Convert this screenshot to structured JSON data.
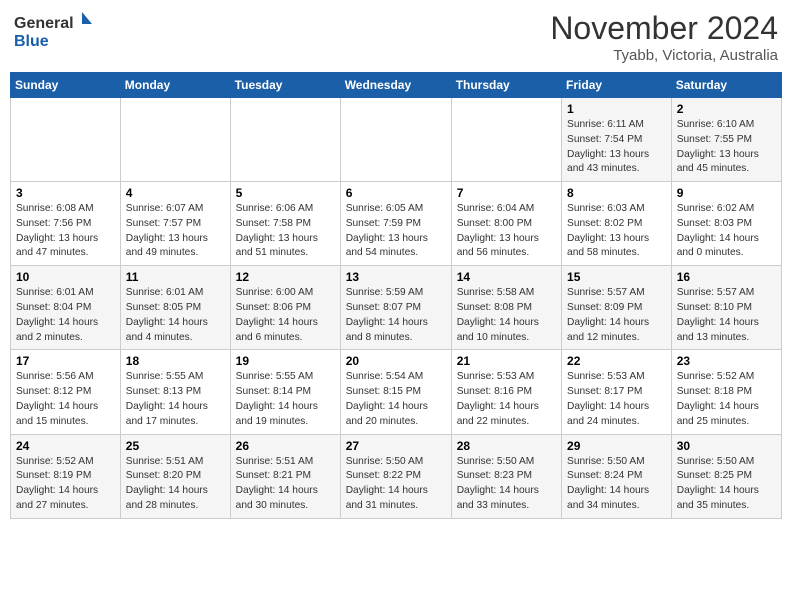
{
  "header": {
    "logo_line1": "General",
    "logo_line2": "Blue",
    "month": "November 2024",
    "location": "Tyabb, Victoria, Australia"
  },
  "weekdays": [
    "Sunday",
    "Monday",
    "Tuesday",
    "Wednesday",
    "Thursday",
    "Friday",
    "Saturday"
  ],
  "weeks": [
    [
      {
        "day": "",
        "info": ""
      },
      {
        "day": "",
        "info": ""
      },
      {
        "day": "",
        "info": ""
      },
      {
        "day": "",
        "info": ""
      },
      {
        "day": "",
        "info": ""
      },
      {
        "day": "1",
        "info": "Sunrise: 6:11 AM\nSunset: 7:54 PM\nDaylight: 13 hours\nand 43 minutes."
      },
      {
        "day": "2",
        "info": "Sunrise: 6:10 AM\nSunset: 7:55 PM\nDaylight: 13 hours\nand 45 minutes."
      }
    ],
    [
      {
        "day": "3",
        "info": "Sunrise: 6:08 AM\nSunset: 7:56 PM\nDaylight: 13 hours\nand 47 minutes."
      },
      {
        "day": "4",
        "info": "Sunrise: 6:07 AM\nSunset: 7:57 PM\nDaylight: 13 hours\nand 49 minutes."
      },
      {
        "day": "5",
        "info": "Sunrise: 6:06 AM\nSunset: 7:58 PM\nDaylight: 13 hours\nand 51 minutes."
      },
      {
        "day": "6",
        "info": "Sunrise: 6:05 AM\nSunset: 7:59 PM\nDaylight: 13 hours\nand 54 minutes."
      },
      {
        "day": "7",
        "info": "Sunrise: 6:04 AM\nSunset: 8:00 PM\nDaylight: 13 hours\nand 56 minutes."
      },
      {
        "day": "8",
        "info": "Sunrise: 6:03 AM\nSunset: 8:02 PM\nDaylight: 13 hours\nand 58 minutes."
      },
      {
        "day": "9",
        "info": "Sunrise: 6:02 AM\nSunset: 8:03 PM\nDaylight: 14 hours\nand 0 minutes."
      }
    ],
    [
      {
        "day": "10",
        "info": "Sunrise: 6:01 AM\nSunset: 8:04 PM\nDaylight: 14 hours\nand 2 minutes."
      },
      {
        "day": "11",
        "info": "Sunrise: 6:01 AM\nSunset: 8:05 PM\nDaylight: 14 hours\nand 4 minutes."
      },
      {
        "day": "12",
        "info": "Sunrise: 6:00 AM\nSunset: 8:06 PM\nDaylight: 14 hours\nand 6 minutes."
      },
      {
        "day": "13",
        "info": "Sunrise: 5:59 AM\nSunset: 8:07 PM\nDaylight: 14 hours\nand 8 minutes."
      },
      {
        "day": "14",
        "info": "Sunrise: 5:58 AM\nSunset: 8:08 PM\nDaylight: 14 hours\nand 10 minutes."
      },
      {
        "day": "15",
        "info": "Sunrise: 5:57 AM\nSunset: 8:09 PM\nDaylight: 14 hours\nand 12 minutes."
      },
      {
        "day": "16",
        "info": "Sunrise: 5:57 AM\nSunset: 8:10 PM\nDaylight: 14 hours\nand 13 minutes."
      }
    ],
    [
      {
        "day": "17",
        "info": "Sunrise: 5:56 AM\nSunset: 8:12 PM\nDaylight: 14 hours\nand 15 minutes."
      },
      {
        "day": "18",
        "info": "Sunrise: 5:55 AM\nSunset: 8:13 PM\nDaylight: 14 hours\nand 17 minutes."
      },
      {
        "day": "19",
        "info": "Sunrise: 5:55 AM\nSunset: 8:14 PM\nDaylight: 14 hours\nand 19 minutes."
      },
      {
        "day": "20",
        "info": "Sunrise: 5:54 AM\nSunset: 8:15 PM\nDaylight: 14 hours\nand 20 minutes."
      },
      {
        "day": "21",
        "info": "Sunrise: 5:53 AM\nSunset: 8:16 PM\nDaylight: 14 hours\nand 22 minutes."
      },
      {
        "day": "22",
        "info": "Sunrise: 5:53 AM\nSunset: 8:17 PM\nDaylight: 14 hours\nand 24 minutes."
      },
      {
        "day": "23",
        "info": "Sunrise: 5:52 AM\nSunset: 8:18 PM\nDaylight: 14 hours\nand 25 minutes."
      }
    ],
    [
      {
        "day": "24",
        "info": "Sunrise: 5:52 AM\nSunset: 8:19 PM\nDaylight: 14 hours\nand 27 minutes."
      },
      {
        "day": "25",
        "info": "Sunrise: 5:51 AM\nSunset: 8:20 PM\nDaylight: 14 hours\nand 28 minutes."
      },
      {
        "day": "26",
        "info": "Sunrise: 5:51 AM\nSunset: 8:21 PM\nDaylight: 14 hours\nand 30 minutes."
      },
      {
        "day": "27",
        "info": "Sunrise: 5:50 AM\nSunset: 8:22 PM\nDaylight: 14 hours\nand 31 minutes."
      },
      {
        "day": "28",
        "info": "Sunrise: 5:50 AM\nSunset: 8:23 PM\nDaylight: 14 hours\nand 33 minutes."
      },
      {
        "day": "29",
        "info": "Sunrise: 5:50 AM\nSunset: 8:24 PM\nDaylight: 14 hours\nand 34 minutes."
      },
      {
        "day": "30",
        "info": "Sunrise: 5:50 AM\nSunset: 8:25 PM\nDaylight: 14 hours\nand 35 minutes."
      }
    ]
  ]
}
